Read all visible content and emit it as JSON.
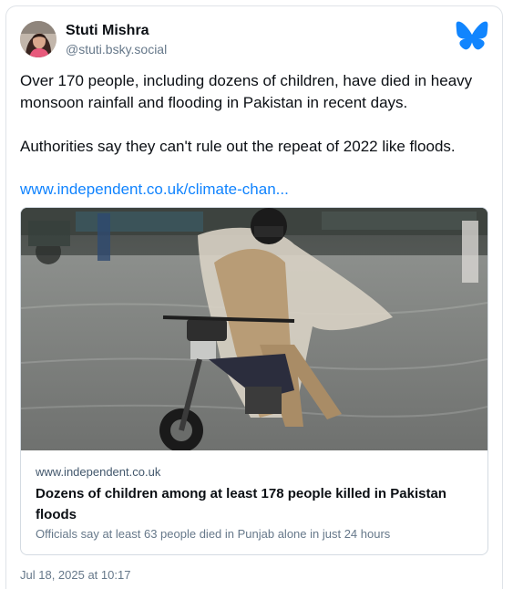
{
  "author": {
    "display_name": "Stuti Mishra",
    "handle": "@stuti.bsky.social",
    "avatar_icon": "profile-photo"
  },
  "brand": {
    "logo_icon": "bluesky-butterfly-icon",
    "color": "#1185fe"
  },
  "post": {
    "paragraph_1": "Over 170 people, including dozens of children, have died in heavy monsoon rainfall and flooding in Pakistan in recent days.",
    "paragraph_2": "Authorities say they can't rule out the repeat of 2022 like floods.",
    "link_text": "www.independent.co.uk/climate-chan..."
  },
  "embed": {
    "image_icon": "flooded-street-motorcycle-photo",
    "domain": "www.independent.co.uk",
    "title": "Dozens of children among at least 178 people killed in Pakistan floods",
    "description": "Officials say at least 63 people died in Punjab alone in just 24 hours"
  },
  "timestamp": "Jul 18, 2025 at 10:17"
}
